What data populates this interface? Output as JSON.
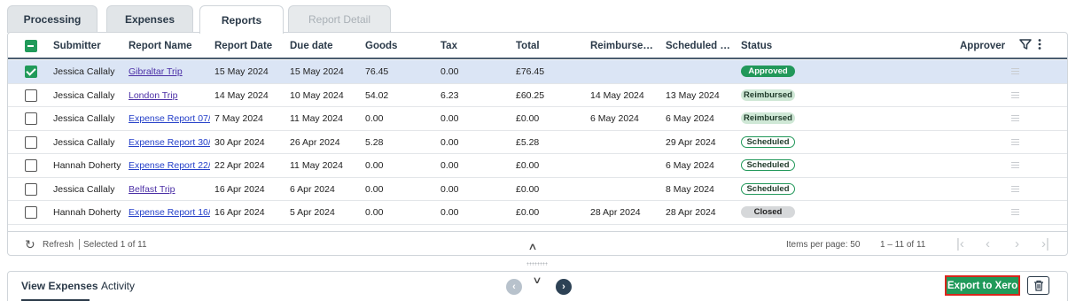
{
  "tabs": [
    "Processing",
    "Expenses",
    "Reports",
    "Report Detail"
  ],
  "columns": {
    "submitter": "Submitter",
    "report_name": "Report Name",
    "report_date": "Report Date",
    "due_date": "Due date",
    "goods": "Goods",
    "tax": "Tax",
    "total": "Total",
    "reimbursed": "Reimburse…",
    "scheduled": "Scheduled …",
    "status": "Status",
    "approver": "Approver"
  },
  "rows": [
    {
      "submitter": "Jessica Callaly",
      "report_name": "Gibraltar Trip",
      "report_date": "15 May 2024",
      "due_date": "15 May 2024",
      "goods": "76.45",
      "tax": "0.00",
      "total": "£76.45",
      "reimbursed": "",
      "scheduled": "",
      "status": "Approved",
      "selected": true
    },
    {
      "submitter": "Jessica Callaly",
      "report_name": "London Trip",
      "report_date": "14 May 2024",
      "due_date": "10 May 2024",
      "goods": "54.02",
      "tax": "6.23",
      "total": "£60.25",
      "reimbursed": "14 May 2024",
      "scheduled": "13 May 2024",
      "status": "Reimbursed",
      "selected": false
    },
    {
      "submitter": "Jessica Callaly",
      "report_name": "Expense Report 07/…",
      "report_date": "7 May 2024",
      "due_date": "11 May 2024",
      "goods": "0.00",
      "tax": "0.00",
      "total": "£0.00",
      "reimbursed": "6 May 2024",
      "scheduled": "6 May 2024",
      "status": "Reimbursed",
      "selected": false
    },
    {
      "submitter": "Jessica Callaly",
      "report_name": "Expense Report 30/…",
      "report_date": "30 Apr 2024",
      "due_date": "26 Apr 2024",
      "goods": "5.28",
      "tax": "0.00",
      "total": "£5.28",
      "reimbursed": "",
      "scheduled": "29 Apr 2024",
      "status": "Scheduled",
      "selected": false
    },
    {
      "submitter": "Hannah Doherty",
      "report_name": "Expense Report 22/…",
      "report_date": "22 Apr 2024",
      "due_date": "11 May 2024",
      "goods": "0.00",
      "tax": "0.00",
      "total": "£0.00",
      "reimbursed": "",
      "scheduled": "6 May 2024",
      "status": "Scheduled",
      "selected": false
    },
    {
      "submitter": "Jessica Callaly",
      "report_name": "Belfast Trip",
      "report_date": "16 Apr 2024",
      "due_date": "6 Apr 2024",
      "goods": "0.00",
      "tax": "0.00",
      "total": "£0.00",
      "reimbursed": "",
      "scheduled": "8 May 2024",
      "status": "Scheduled",
      "selected": false
    },
    {
      "submitter": "Hannah Doherty",
      "report_name": "Expense Report 16/…",
      "report_date": "16 Apr 2024",
      "due_date": "5 Apr 2024",
      "goods": "0.00",
      "tax": "0.00",
      "total": "£0.00",
      "reimbursed": "28 Apr 2024",
      "scheduled": "28 Apr 2024",
      "status": "Closed",
      "selected": false
    }
  ],
  "footer": {
    "refresh": "Refresh",
    "selected": "Selected 1 of 11",
    "items_per_page": "Items per page: 50",
    "range": "1 – 11 of 11"
  },
  "panel": {
    "tab_view_expenses": "View Expenses",
    "tab_activity": "Activity",
    "export_label": "Export to Xero"
  },
  "colors": {
    "accent_green": "#219a5a",
    "highlight_red": "#d9261c",
    "dark_navy": "#2b3a49"
  }
}
